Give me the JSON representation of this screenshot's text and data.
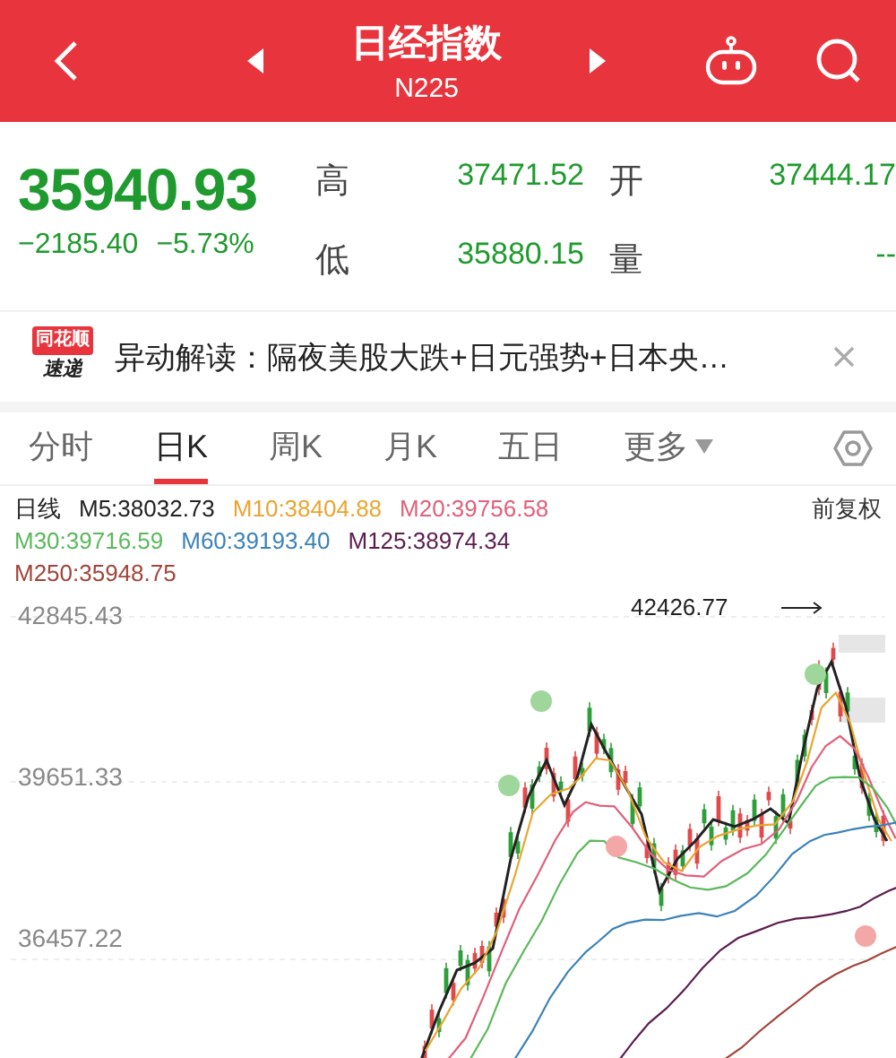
{
  "header": {
    "title": "日经指数",
    "code": "N225"
  },
  "quote": {
    "price": "35940.93",
    "change": "−2185.40",
    "change_pct": "−5.73%",
    "stats": [
      {
        "label": "高",
        "value": "37471.52"
      },
      {
        "label": "开",
        "value": "37444.17"
      },
      {
        "label": "低",
        "value": "35880.15"
      },
      {
        "label": "量",
        "value": "--"
      }
    ]
  },
  "news": {
    "badge": [
      "同花顺",
      "速递"
    ],
    "text": "异动解读：隔夜美股大跌+日元强势+日本央…"
  },
  "tabs": [
    {
      "label": "分时",
      "selected": false
    },
    {
      "label": "日K",
      "selected": true
    },
    {
      "label": "周K",
      "selected": false
    },
    {
      "label": "月K",
      "selected": false
    },
    {
      "label": "五日",
      "selected": false
    },
    {
      "label": "更多",
      "selected": false,
      "dropdown": true
    }
  ],
  "legend": {
    "period": "日线",
    "adjust": "前复权",
    "mas": [
      {
        "label": "M5:38032.73",
        "color": "#222222"
      },
      {
        "label": "M10:38404.88",
        "color": "#e8a531"
      },
      {
        "label": "M20:39756.58",
        "color": "#e0607a"
      },
      {
        "label": "M30:39716.59",
        "color": "#5cb85c"
      },
      {
        "label": "M60:39193.40",
        "color": "#3b82b8"
      },
      {
        "label": "M125:38974.34",
        "color": "#5a1e4f"
      },
      {
        "label": "M250:35948.75",
        "color": "#a0453a"
      }
    ]
  },
  "chart": {
    "yticks": [
      "42845.43",
      "39651.33",
      "36457.22"
    ],
    "high_label": "42426.77"
  }
}
